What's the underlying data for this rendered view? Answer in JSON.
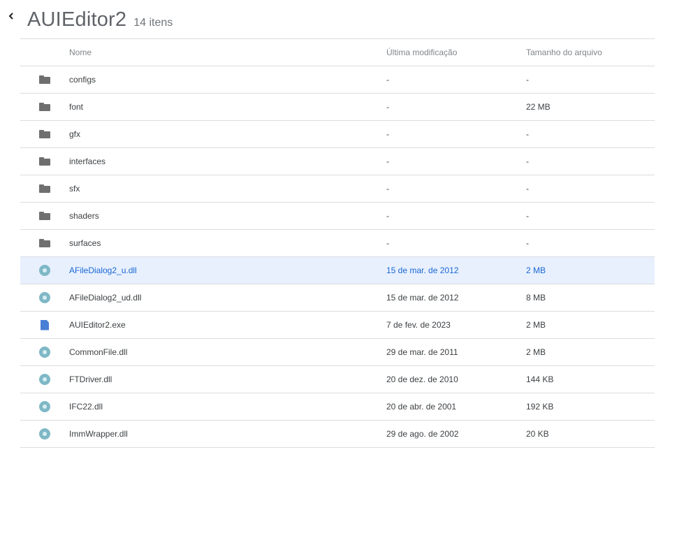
{
  "header": {
    "title": "AUIEditor2",
    "count": "14 itens"
  },
  "columns": {
    "name": "Nome",
    "modified": "Última modificação",
    "size": "Tamanho do arquivo"
  },
  "rows": [
    {
      "icon": "folder-icon",
      "name": "configs",
      "modified": "-",
      "size": "-"
    },
    {
      "icon": "folder-icon",
      "name": "font",
      "modified": "-",
      "size": "22 MB"
    },
    {
      "icon": "folder-icon",
      "name": "gfx",
      "modified": "-",
      "size": "-"
    },
    {
      "icon": "folder-icon",
      "name": "interfaces",
      "modified": "-",
      "size": "-"
    },
    {
      "icon": "folder-icon",
      "name": "sfx",
      "modified": "-",
      "size": "-"
    },
    {
      "icon": "folder-icon",
      "name": "shaders",
      "modified": "-",
      "size": "-"
    },
    {
      "icon": "folder-icon",
      "name": "surfaces",
      "modified": "-",
      "size": "-"
    },
    {
      "icon": "disc-icon",
      "name": "AFileDialog2_u.dll",
      "modified": "15 de mar. de 2012",
      "size": "2 MB",
      "selected": true
    },
    {
      "icon": "disc-icon",
      "name": "AFileDialog2_ud.dll",
      "modified": "15 de mar. de 2012",
      "size": "8 MB"
    },
    {
      "icon": "document-icon",
      "name": "AUIEditor2.exe",
      "modified": "7 de fev. de 2023",
      "size": "2 MB"
    },
    {
      "icon": "disc-icon",
      "name": "CommonFile.dll",
      "modified": "29 de mar. de 2011",
      "size": "2 MB"
    },
    {
      "icon": "disc-icon",
      "name": "FTDriver.dll",
      "modified": "20 de dez. de 2010",
      "size": "144 KB"
    },
    {
      "icon": "disc-icon",
      "name": "IFC22.dll",
      "modified": "20 de abr. de 2001",
      "size": "192 KB"
    },
    {
      "icon": "disc-icon",
      "name": "ImmWrapper.dll",
      "modified": "29 de ago. de 2002",
      "size": "20 KB"
    }
  ],
  "colors": {
    "selected_bg": "#e8f0fe",
    "selected_text": "#1967d2",
    "folder": "#6f6f6f",
    "disc": "#7fb8c6",
    "document": "#4a7fd6"
  }
}
